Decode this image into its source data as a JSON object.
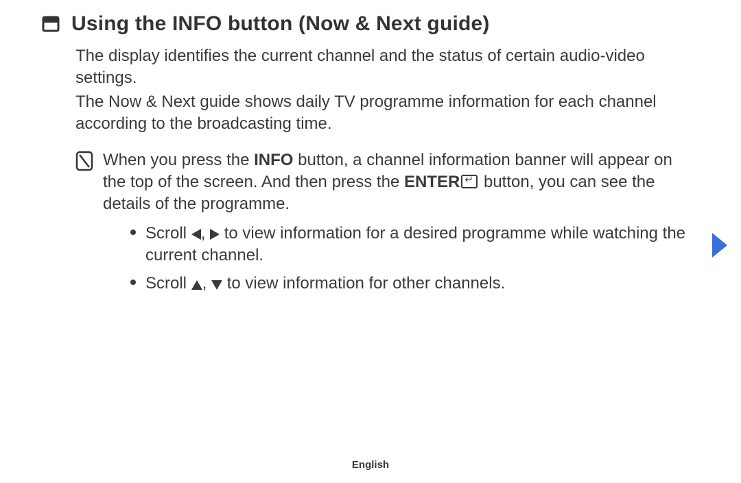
{
  "heading": "Using the INFO button (Now & Next guide)",
  "para1": "The display identifies the current channel and the status of certain audio-video settings.",
  "para2": "The Now & Next guide shows daily TV programme information for each channel according to the broadcasting time.",
  "note": {
    "pre": "When you press the ",
    "info": "INFO",
    "mid": " button, a channel information banner will appear on the top of the screen. And then press the ",
    "enter": "ENTER",
    "post": " button, you can see the details of the programme."
  },
  "bullets": {
    "b1": {
      "pre": "Scroll ",
      "post": " to view information for a desired programme while watching the current channel."
    },
    "b2": {
      "pre": "Scroll ",
      "post": " to view information for other channels."
    }
  },
  "comma": ", ",
  "footer": "English"
}
